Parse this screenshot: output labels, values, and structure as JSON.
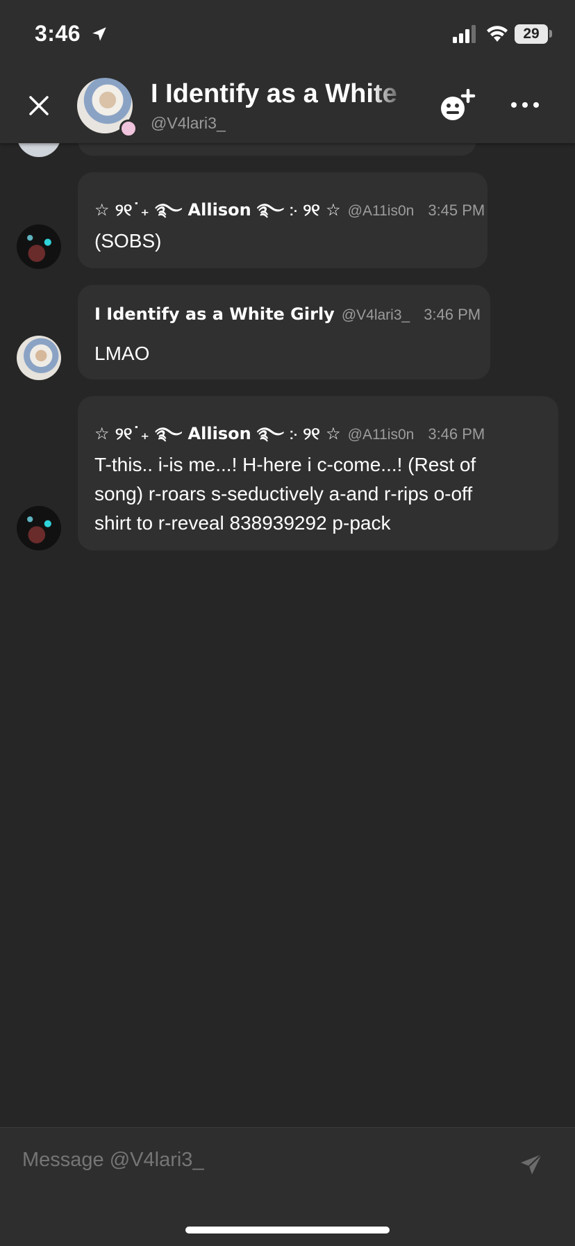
{
  "status_bar": {
    "time": "3:46",
    "battery": "29"
  },
  "header": {
    "title": "I Identify as a White",
    "subtitle": "@V4lari3_"
  },
  "messages": [
    {
      "name": "☆ ୨୧˙₊ ࿐ Allison ࿐ ჻ ୨୧ ☆",
      "handle": "@A11is0n",
      "time": "3:45 PM",
      "lines": [
        "(SOBS)"
      ]
    },
    {
      "name": "I Identify as a White Girly",
      "handle": "@V4lari3_",
      "time": "3:46 PM",
      "lines": [
        "LMAO"
      ]
    },
    {
      "name": "☆ ୨୧˙₊ ࿐ Allison ࿐ ჻ ୨୧ ☆",
      "handle": "@A11is0n",
      "time": "3:46 PM",
      "lines": [
        "T-this.. i-is me...! H-here i c-come...! (Rest of",
        "song) r-roars s-seductively a-and r-rips o-off",
        "shirt to r-reveal 838939292 p-pack"
      ]
    }
  ],
  "composer": {
    "placeholder": "Message @V4lari3_"
  },
  "colors": {
    "background": "#262626",
    "bubble": "#303030",
    "header": "#2e2e2e",
    "secondary_text": "#9c9c9c",
    "presence_dot": "#f0c4dc"
  },
  "icons": [
    "location-arrow-icon",
    "cellular-signal-icon",
    "wifi-icon",
    "battery-icon",
    "close-icon",
    "add-friend-icon",
    "more-icon",
    "send-icon"
  ]
}
